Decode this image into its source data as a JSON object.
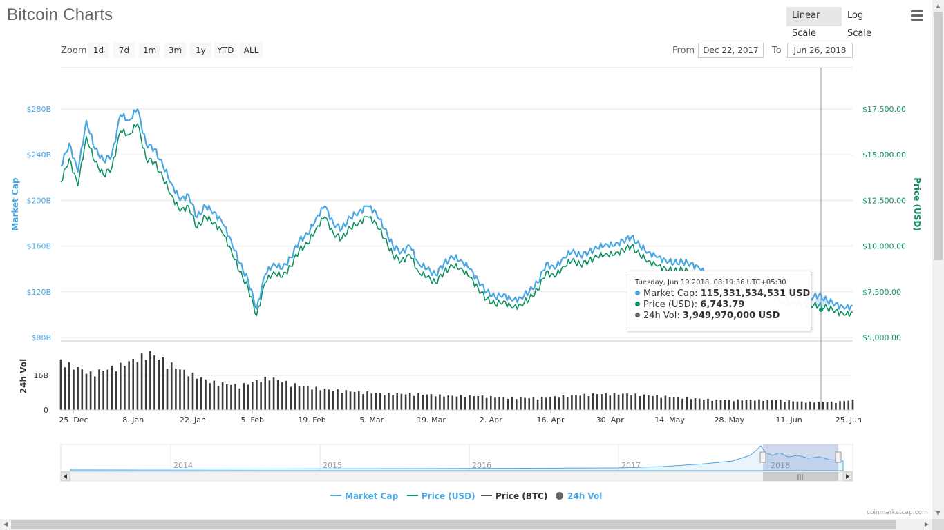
{
  "header": {
    "title": "Bitcoin Charts",
    "scale_linear": "Linear Scale",
    "scale_log": "Log Scale",
    "active_scale": "linear"
  },
  "zoom": {
    "label": "Zoom",
    "buttons": [
      "1d",
      "7d",
      "1m",
      "3m",
      "1y",
      "YTD",
      "ALL"
    ]
  },
  "range": {
    "from_label": "From",
    "from_value": "Dec 22, 2017",
    "to_label": "To",
    "to_value": "Jun 26, 2018"
  },
  "colors": {
    "market_cap": "#4aa7e2",
    "price_usd": "#0c9160",
    "price_btc": "#555555",
    "volume": "#3a3a3a"
  },
  "tooltip": {
    "date": "Tuesday, Jun 19 2018, 08:19:36 UTC+05:30",
    "rows": [
      {
        "label": "Market Cap",
        "value": "115,331,534,531 USD"
      },
      {
        "label": "Price (USD)",
        "value": "6,743.79"
      },
      {
        "label": "24h Vol",
        "value": "3,949,970,000 USD"
      }
    ]
  },
  "legend": [
    "Market Cap",
    "Price (USD)",
    "Price (BTC)",
    "24h Vol"
  ],
  "credit": "coinmarketcap.com",
  "chart_data": {
    "type": "line",
    "x_tick_labels": [
      "25. Dec",
      "8. Jan",
      "22. Jan",
      "5. Feb",
      "19. Feb",
      "5. Mar",
      "19. Mar",
      "2. Apr",
      "16. Apr",
      "30. Apr",
      "14. May",
      "28. May",
      "11. Jun",
      "25. Jun"
    ],
    "xlim": [
      "2017-12-22",
      "2018-06-26"
    ],
    "left_axis": {
      "label": "Market Cap",
      "ticks": [
        "$80B",
        "$120B",
        "$160B",
        "$200B",
        "$240B",
        "$280B"
      ],
      "ylim": [
        80,
        300
      ]
    },
    "right_axis": {
      "label": "Price (USD)",
      "ticks": [
        "$5,000.00",
        "$7,500.00",
        "$10,000.00",
        "$12,500.00",
        "$15,000.00",
        "$17,500.00"
      ],
      "ylim": [
        5000,
        17500
      ]
    },
    "volume_axis": {
      "label": "24h Vol",
      "ticks": [
        "0",
        "16B"
      ],
      "ylim": [
        0,
        32
      ]
    },
    "series": [
      {
        "name": "Market Cap",
        "unit": "billion USD",
        "x": [
          "2017-12-22",
          "2017-12-24",
          "2017-12-26",
          "2017-12-28",
          "2017-12-30",
          "2018-01-01",
          "2018-01-03",
          "2018-01-05",
          "2018-01-07",
          "2018-01-09",
          "2018-01-11",
          "2018-01-13",
          "2018-01-15",
          "2018-01-17",
          "2018-01-19",
          "2018-01-21",
          "2018-01-23",
          "2018-01-25",
          "2018-01-27",
          "2018-01-29",
          "2018-01-31",
          "2018-02-02",
          "2018-02-04",
          "2018-02-06",
          "2018-02-08",
          "2018-02-10",
          "2018-02-12",
          "2018-02-14",
          "2018-02-16",
          "2018-02-18",
          "2018-02-20",
          "2018-02-22",
          "2018-02-24",
          "2018-02-26",
          "2018-02-28",
          "2018-03-02",
          "2018-03-04",
          "2018-03-06",
          "2018-03-08",
          "2018-03-10",
          "2018-03-12",
          "2018-03-14",
          "2018-03-16",
          "2018-03-18",
          "2018-03-20",
          "2018-03-22",
          "2018-03-24",
          "2018-03-26",
          "2018-03-28",
          "2018-03-30",
          "2018-04-01",
          "2018-04-03",
          "2018-04-05",
          "2018-04-07",
          "2018-04-09",
          "2018-04-11",
          "2018-04-13",
          "2018-04-15",
          "2018-04-17",
          "2018-04-19",
          "2018-04-21",
          "2018-04-23",
          "2018-04-25",
          "2018-04-27",
          "2018-04-29",
          "2018-05-01",
          "2018-05-03",
          "2018-05-05",
          "2018-05-07",
          "2018-05-09",
          "2018-05-11",
          "2018-05-13",
          "2018-05-15",
          "2018-05-17",
          "2018-05-19",
          "2018-05-21",
          "2018-05-23",
          "2018-05-25",
          "2018-05-27",
          "2018-05-29",
          "2018-05-31",
          "2018-06-02",
          "2018-06-04",
          "2018-06-06",
          "2018-06-08",
          "2018-06-10",
          "2018-06-12",
          "2018-06-14",
          "2018-06-16",
          "2018-06-18",
          "2018-06-20",
          "2018-06-22",
          "2018-06-24",
          "2018-06-26"
        ],
        "values": [
          230,
          250,
          225,
          270,
          245,
          235,
          240,
          275,
          270,
          280,
          250,
          245,
          230,
          215,
          200,
          205,
          185,
          195,
          190,
          180,
          165,
          145,
          130,
          105,
          135,
          145,
          140,
          150,
          165,
          170,
          185,
          195,
          180,
          175,
          185,
          190,
          195,
          190,
          175,
          160,
          155,
          160,
          145,
          140,
          135,
          145,
          150,
          148,
          140,
          130,
          120,
          115,
          118,
          112,
          115,
          120,
          128,
          145,
          140,
          150,
          155,
          152,
          155,
          158,
          162,
          160,
          165,
          168,
          160,
          155,
          150,
          148,
          145,
          146,
          145,
          140,
          135,
          130,
          132,
          128,
          128,
          130,
          128,
          125,
          120,
          115,
          118,
          115,
          115,
          117,
          112,
          110,
          105,
          108
        ]
      },
      {
        "name": "Price (USD)",
        "unit": "USD",
        "x": [
          "2017-12-22",
          "2017-12-24",
          "2017-12-26",
          "2017-12-28",
          "2017-12-30",
          "2018-01-01",
          "2018-01-03",
          "2018-01-05",
          "2018-01-07",
          "2018-01-09",
          "2018-01-11",
          "2018-01-13",
          "2018-01-15",
          "2018-01-17",
          "2018-01-19",
          "2018-01-21",
          "2018-01-23",
          "2018-01-25",
          "2018-01-27",
          "2018-01-29",
          "2018-01-31",
          "2018-02-02",
          "2018-02-04",
          "2018-02-06",
          "2018-02-08",
          "2018-02-10",
          "2018-02-12",
          "2018-02-14",
          "2018-02-16",
          "2018-02-18",
          "2018-02-20",
          "2018-02-22",
          "2018-02-24",
          "2018-02-26",
          "2018-02-28",
          "2018-03-02",
          "2018-03-04",
          "2018-03-06",
          "2018-03-08",
          "2018-03-10",
          "2018-03-12",
          "2018-03-14",
          "2018-03-16",
          "2018-03-18",
          "2018-03-20",
          "2018-03-22",
          "2018-03-24",
          "2018-03-26",
          "2018-03-28",
          "2018-03-30",
          "2018-04-01",
          "2018-04-03",
          "2018-04-05",
          "2018-04-07",
          "2018-04-09",
          "2018-04-11",
          "2018-04-13",
          "2018-04-15",
          "2018-04-17",
          "2018-04-19",
          "2018-04-21",
          "2018-04-23",
          "2018-04-25",
          "2018-04-27",
          "2018-04-29",
          "2018-05-01",
          "2018-05-03",
          "2018-05-05",
          "2018-05-07",
          "2018-05-09",
          "2018-05-11",
          "2018-05-13",
          "2018-05-15",
          "2018-05-17",
          "2018-05-19",
          "2018-05-21",
          "2018-05-23",
          "2018-05-25",
          "2018-05-27",
          "2018-05-29",
          "2018-05-31",
          "2018-06-02",
          "2018-06-04",
          "2018-06-06",
          "2018-06-08",
          "2018-06-10",
          "2018-06-12",
          "2018-06-14",
          "2018-06-16",
          "2018-06-18",
          "2018-06-20",
          "2018-06-22",
          "2018-06-24",
          "2018-06-26"
        ],
        "values": [
          13500,
          14800,
          13300,
          16000,
          14600,
          13900,
          14300,
          16300,
          16100,
          16700,
          14800,
          14600,
          13700,
          12800,
          11900,
          12200,
          11000,
          11600,
          11300,
          10700,
          9800,
          8600,
          7700,
          6200,
          8000,
          8600,
          8300,
          8900,
          9800,
          10100,
          11000,
          11600,
          10700,
          10400,
          11000,
          11300,
          11600,
          11300,
          10400,
          9500,
          9200,
          9500,
          8600,
          8300,
          8000,
          8600,
          8900,
          8800,
          8300,
          7700,
          7100,
          6800,
          7000,
          6600,
          6800,
          7100,
          7600,
          8600,
          8300,
          8900,
          9200,
          9000,
          9200,
          9400,
          9600,
          9500,
          9800,
          10000,
          9500,
          9200,
          8900,
          8800,
          8600,
          8700,
          8600,
          8300,
          8000,
          7700,
          7800,
          7600,
          7600,
          7700,
          7600,
          7400,
          7100,
          6800,
          7000,
          6800,
          6800,
          6740,
          6600,
          6500,
          6200,
          6400
        ]
      },
      {
        "name": "24h Vol",
        "unit": "billion USD",
        "x": [
          "2017-12-22",
          "2017-12-29",
          "2018-01-05",
          "2018-01-12",
          "2018-01-19",
          "2018-01-26",
          "2018-02-02",
          "2018-02-09",
          "2018-02-16",
          "2018-02-23",
          "2018-03-02",
          "2018-03-09",
          "2018-03-16",
          "2018-03-23",
          "2018-03-30",
          "2018-04-06",
          "2018-04-13",
          "2018-04-20",
          "2018-04-27",
          "2018-05-04",
          "2018-05-11",
          "2018-05-18",
          "2018-05-25",
          "2018-06-01",
          "2018-06-08",
          "2018-06-15",
          "2018-06-22",
          "2018-06-26"
        ],
        "values": [
          24,
          18,
          22,
          28,
          20,
          14,
          12,
          16,
          12,
          10,
          9,
          8,
          8,
          7,
          7,
          6,
          6,
          7,
          8,
          8,
          7,
          6,
          5,
          5,
          5,
          4,
          4,
          5
        ]
      }
    ],
    "navigator_labels": [
      "2014",
      "2015",
      "2016",
      "2017",
      "2018"
    ],
    "grid": true,
    "legend_position": "bottom"
  }
}
